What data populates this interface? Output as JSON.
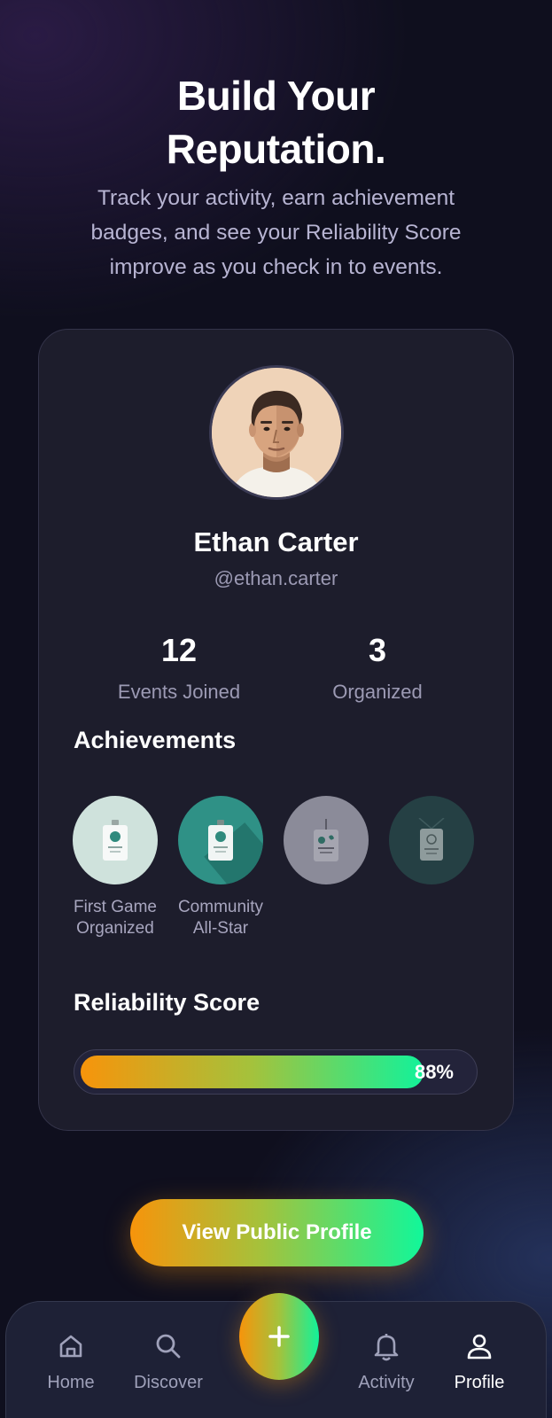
{
  "hero": {
    "title_line1": "Build Your",
    "title_line2": "Reputation.",
    "subtitle": "Track your activity, earn achievement badges, and see your Reliability Score improve as you check in to events."
  },
  "profile": {
    "name": "Ethan Carter",
    "handle": "@ethan.carter",
    "avatar_icon": "user-avatar-illustration"
  },
  "stats": [
    {
      "value": "12",
      "label": "Events Joined"
    },
    {
      "value": "3",
      "label": "Organized"
    }
  ],
  "achievements": {
    "title": "Achievements",
    "badges": [
      {
        "label": "First Game Organized",
        "color": "#cfe2dc",
        "icon": "id-badge-icon",
        "locked": false
      },
      {
        "label": "Community All-Star",
        "color": "#2f9186",
        "icon": "id-badge-icon",
        "locked": false
      },
      {
        "label": "",
        "color": "#8b8b99",
        "icon": "id-badge-icon",
        "locked": true
      },
      {
        "label": "",
        "color": "#254044",
        "icon": "id-badge-icon",
        "locked": true
      }
    ]
  },
  "reliability": {
    "title": "Reliability Score",
    "percent": 88,
    "percent_label": "88%"
  },
  "cta": {
    "label": "View Public Profile"
  },
  "tabbar": {
    "items": [
      {
        "label": "Home",
        "icon": "home-icon",
        "active": false
      },
      {
        "label": "Discover",
        "icon": "search-icon",
        "active": false
      },
      {
        "label": "Activity",
        "icon": "bell-icon",
        "active": false
      },
      {
        "label": "Profile",
        "icon": "user-icon",
        "active": true
      }
    ],
    "fab_icon": "plus-icon"
  },
  "colors": {
    "background": "#0f0f1e",
    "card": "#1d1d2c",
    "accent_start": "#f7940b",
    "accent_end": "#12f29a",
    "muted_text": "#9c9ab4"
  }
}
